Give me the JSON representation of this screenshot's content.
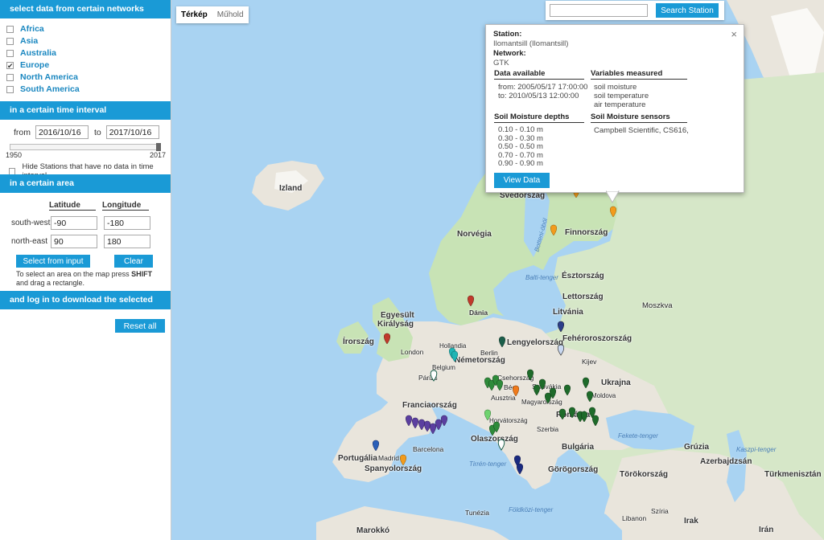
{
  "sidebar": {
    "networks_header": "select data from certain networks",
    "networks": [
      {
        "label": "Africa",
        "checked": false
      },
      {
        "label": "Asia",
        "checked": false
      },
      {
        "label": "Australia",
        "checked": false
      },
      {
        "label": "Europe",
        "checked": true
      },
      {
        "label": "North America",
        "checked": false
      },
      {
        "label": "South America",
        "checked": false
      }
    ],
    "time_header": "in a certain time interval",
    "from_label": "from",
    "from_value": "2016/10/16",
    "to_label": "to",
    "to_value": "2017/10/16",
    "slider_min": "1950",
    "slider_max": "2017",
    "hide_label": "Hide Stations that have no data in time interval.",
    "area_header": "in a certain area",
    "lat_header": "Latitude",
    "lon_header": "Longitude",
    "sw_label": "south-west",
    "sw_lat": "-90",
    "sw_lon": "-180",
    "ne_label": "north-east",
    "ne_lat": "90",
    "ne_lon": "180",
    "select_btn": "Select from input",
    "clear_btn": "Clear",
    "hint_pre": "To select an area on the map press ",
    "hint_key": "SHIFT",
    "hint_post": "and drag a rectangle.",
    "download_header": "and log in to download the selected data",
    "reset_btn": "Reset all"
  },
  "map": {
    "tabs": [
      "Térkép",
      "Műhold"
    ],
    "search_btn": "Search Station",
    "places": [
      {
        "t": "Izland",
        "cls": "big"
      },
      {
        "t": "Svédország",
        "cls": "big"
      },
      {
        "t": "Norvégia",
        "cls": "big"
      },
      {
        "t": "Finnország",
        "cls": "big"
      },
      {
        "t": "Botteni-öböl",
        "cls": "sea"
      },
      {
        "t": "Balti-tenger",
        "cls": "sea"
      },
      {
        "t": "Észtország",
        "cls": "big"
      },
      {
        "t": "Lettország",
        "cls": "big"
      },
      {
        "t": "Moszkva",
        "cls": ""
      },
      {
        "t": "Dánia",
        "cls": "big"
      },
      {
        "t": "Litvánia",
        "cls": "big"
      },
      {
        "t": "Egyesült",
        "cls": "big"
      },
      {
        "t": "Királyság",
        "cls": "big"
      },
      {
        "t": "Írország",
        "cls": "big"
      },
      {
        "t": "Fehéroroszország",
        "cls": "big"
      },
      {
        "t": "London",
        "cls": ""
      },
      {
        "t": "Hollandia",
        "cls": ""
      },
      {
        "t": "Berlin",
        "cls": ""
      },
      {
        "t": "Lengyelország",
        "cls": "big"
      },
      {
        "t": "Belgium",
        "cls": ""
      },
      {
        "t": "Németország",
        "cls": "big"
      },
      {
        "t": "Kijev",
        "cls": ""
      },
      {
        "t": "Párizs",
        "cls": ""
      },
      {
        "t": "Csehország",
        "cls": ""
      },
      {
        "t": "Szlovákia",
        "cls": ""
      },
      {
        "t": "Bécs",
        "cls": ""
      },
      {
        "t": "Ukrajna",
        "cls": "big"
      },
      {
        "t": "Ausztria",
        "cls": ""
      },
      {
        "t": "Magyarország",
        "cls": ""
      },
      {
        "t": "Moldova",
        "cls": ""
      },
      {
        "t": "Franciaország",
        "cls": "big"
      },
      {
        "t": "Horvátország",
        "cls": ""
      },
      {
        "t": "Románia",
        "cls": "big"
      },
      {
        "t": "Szerbia",
        "cls": ""
      },
      {
        "t": "Olaszország",
        "cls": "big"
      },
      {
        "t": "Fekete-tenger",
        "cls": "sea"
      },
      {
        "t": "Bulgária",
        "cls": "big"
      },
      {
        "t": "Barcelona",
        "cls": ""
      },
      {
        "t": "Grúzia",
        "cls": "big"
      },
      {
        "t": "Kaszpi-tenger",
        "cls": "sea"
      },
      {
        "t": "Portugália",
        "cls": "big"
      },
      {
        "t": "Madrid",
        "cls": ""
      },
      {
        "t": "Spanyolország",
        "cls": "big"
      },
      {
        "t": "Azerbajdzsán",
        "cls": "big"
      },
      {
        "t": "Tirrén-tenger",
        "cls": "sea"
      },
      {
        "t": "Görögország",
        "cls": "big"
      },
      {
        "t": "Törökország",
        "cls": "big"
      },
      {
        "t": "Türkmenisztán",
        "cls": "big"
      },
      {
        "t": "Tunézia",
        "cls": ""
      },
      {
        "t": "Földközi-tenger",
        "cls": "sea"
      },
      {
        "t": "Szíria",
        "cls": ""
      },
      {
        "t": "Marokkó",
        "cls": "big"
      },
      {
        "t": "Irak",
        "cls": "big"
      },
      {
        "t": "Irán",
        "cls": "big"
      },
      {
        "t": "Libanon",
        "cls": ""
      }
    ]
  },
  "popup": {
    "station_label": "Station:",
    "station_value": "Ilomantsill (Ilomantsill)",
    "network_label": "Network:",
    "network_value": "GTK",
    "data_available_h": "Data available",
    "variables_h": "Variables measured",
    "from_line": "from: 2005/05/17 17:00:00",
    "to_line": "to: 2010/05/13 12:00:00",
    "variables": [
      "soil moisture",
      "soil temperature",
      "air temperature"
    ],
    "depths_h": "Soil Moisture depths",
    "sensors_h": "Soil Moisture sensors",
    "depths": [
      "0.10 - 0.10 m",
      "0.30 - 0.30 m",
      "0.50 - 0.50 m",
      "0.70 - 0.70 m",
      "0.90 - 0.90 m"
    ],
    "sensor": "Campbell Scientific, CS616,",
    "view_btn": "View Data",
    "close": "×"
  },
  "colors": {
    "accent": "#1a9ad6",
    "link": "#1a87c0",
    "sea": "#a9d3f2",
    "land": "#e9e5dc",
    "forest": "#c8e3b5"
  }
}
